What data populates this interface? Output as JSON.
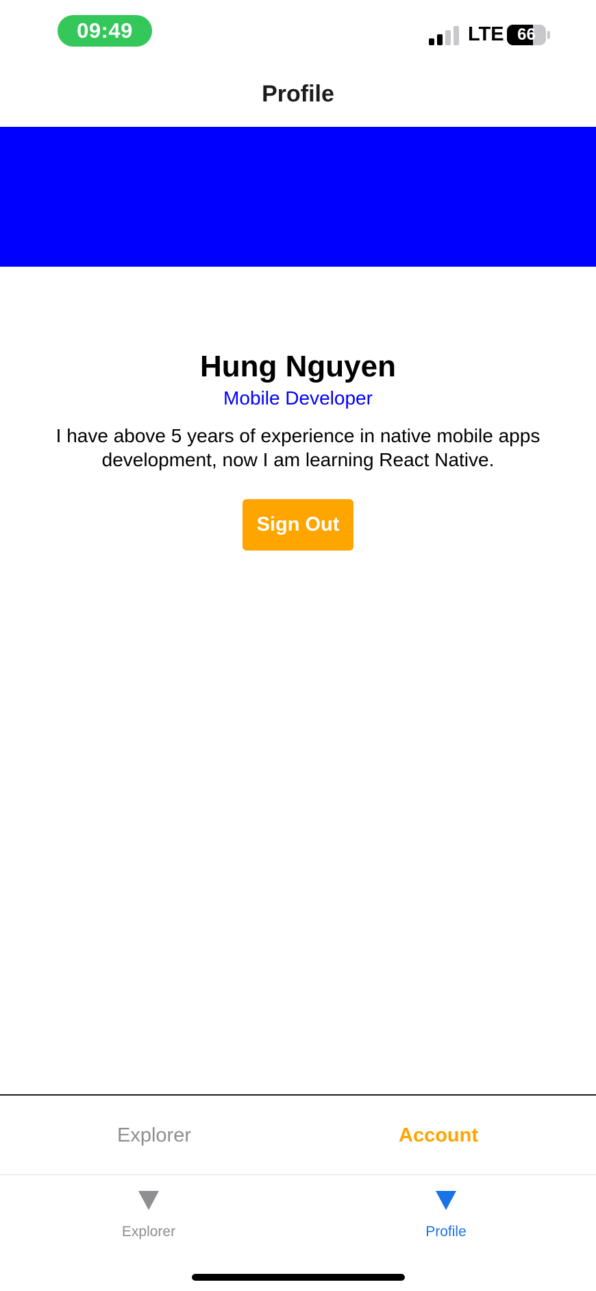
{
  "status_bar": {
    "time": "09:49",
    "network": "LTE",
    "battery": "66",
    "battery_level": 0.66
  },
  "header": {
    "title": "Profile"
  },
  "colors": {
    "banner": "#0000ff",
    "accent": "#ffa500",
    "active_tab": "#1a73e8",
    "inactive": "#8e8e93",
    "time_pill": "#34c759"
  },
  "profile": {
    "name": "Hung Nguyen",
    "role": "Mobile Developer",
    "bio": "I have above 5 years of experience in native mobile apps development, now I am learning React Native.",
    "sign_out_label": "Sign Out"
  },
  "inner_tabs": [
    {
      "label": "Explorer",
      "active": false
    },
    {
      "label": "Account",
      "active": true
    }
  ],
  "tab_bar": [
    {
      "label": "Explorer",
      "icon": "triangle-down-icon",
      "active": false
    },
    {
      "label": "Profile",
      "icon": "triangle-down-icon",
      "active": true
    }
  ]
}
